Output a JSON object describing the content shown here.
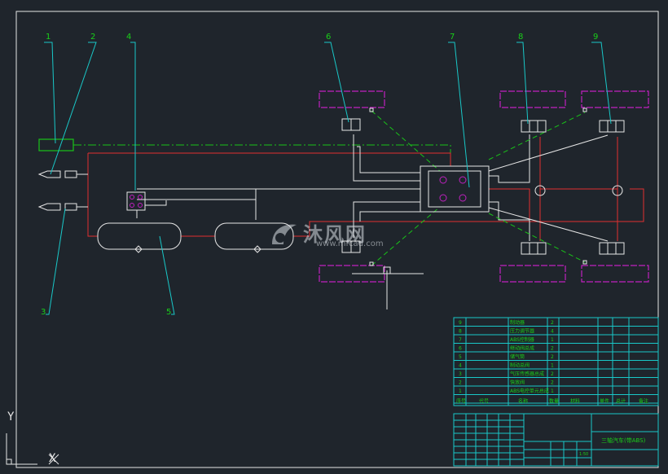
{
  "callouts": [
    "1",
    "2",
    "3",
    "4",
    "5",
    "6",
    "7",
    "8",
    "9"
  ],
  "parts_list": [
    {
      "no": "9",
      "name": "制动器",
      "qty": "2"
    },
    {
      "no": "8",
      "name": "压力调节器",
      "qty": "4"
    },
    {
      "no": "7",
      "name": "ABS控制器",
      "qty": "1"
    },
    {
      "no": "6",
      "name": "继动阀总成",
      "qty": "2"
    },
    {
      "no": "5",
      "name": "储气筒",
      "qty": "2"
    },
    {
      "no": "4",
      "name": "制动总阀",
      "qty": "1"
    },
    {
      "no": "3",
      "name": "气压传感器总成",
      "qty": "2"
    },
    {
      "no": "2",
      "name": "快放阀",
      "qty": "2"
    },
    {
      "no": "1",
      "name": "ABS电控单元总成",
      "qty": "1"
    }
  ],
  "parts_header": [
    "序号",
    "代号",
    "名称",
    "数量",
    "材料",
    "单件",
    "总计",
    "备注"
  ],
  "title_block": {
    "drawing_title": "三轴汽车(带ABS)",
    "scale": "1:50"
  },
  "watermark": {
    "main": "沐风网",
    "sub": "www.mfcad.com"
  },
  "ucs": {
    "y": "Y",
    "x": "X"
  },
  "colors": {
    "frame": "#e6e6e6",
    "air_line": "#e03030",
    "pipe": "#e6e6e6",
    "signal": "#19c319",
    "leader": "#19c8c8",
    "wheel": "#c020c0",
    "table": "#19c8c8",
    "table_text": "#19d019",
    "callout_text": "#19d019"
  }
}
